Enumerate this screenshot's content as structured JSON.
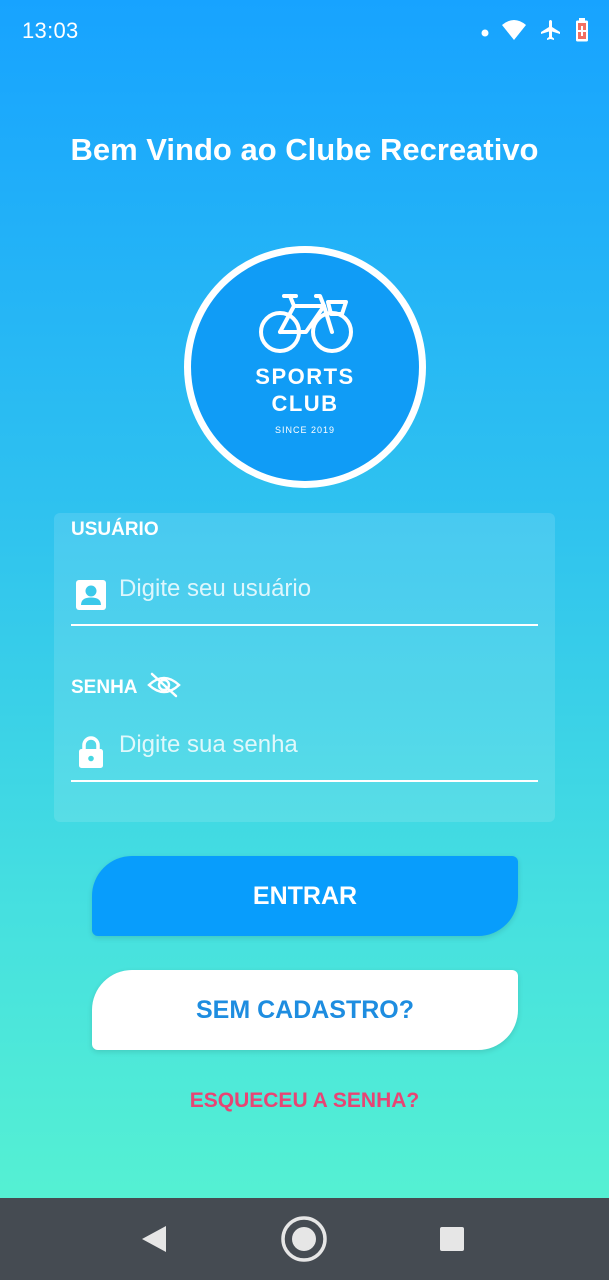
{
  "status_bar": {
    "time": "13:03",
    "icons": [
      "dot-icon",
      "wifi-icon",
      "airplane-icon",
      "battery-icon"
    ]
  },
  "welcome_title": "Bem Vindo ao Clube Recreativo",
  "logo": {
    "line1": "SPORTS",
    "line2": "CLUB",
    "since": "SINCE 2019",
    "icon": "bicycle-icon"
  },
  "form": {
    "username_label": "USUÁRIO",
    "username_placeholder": "Digite seu usuário",
    "username_value": "",
    "password_label": "SENHA",
    "password_placeholder": "Digite sua senha",
    "password_value": ""
  },
  "buttons": {
    "enter": "ENTRAR",
    "register": "SEM CADASTRO?",
    "forgot": "ESQUECEU A SENHA?"
  },
  "colors": {
    "gradient_top": "#17a3ff",
    "gradient_bottom": "#59f5cf",
    "primary_button": "#089dfc",
    "register_text": "#1e8de0",
    "forgot_text": "#e84474",
    "nav_bar": "#454b52"
  }
}
